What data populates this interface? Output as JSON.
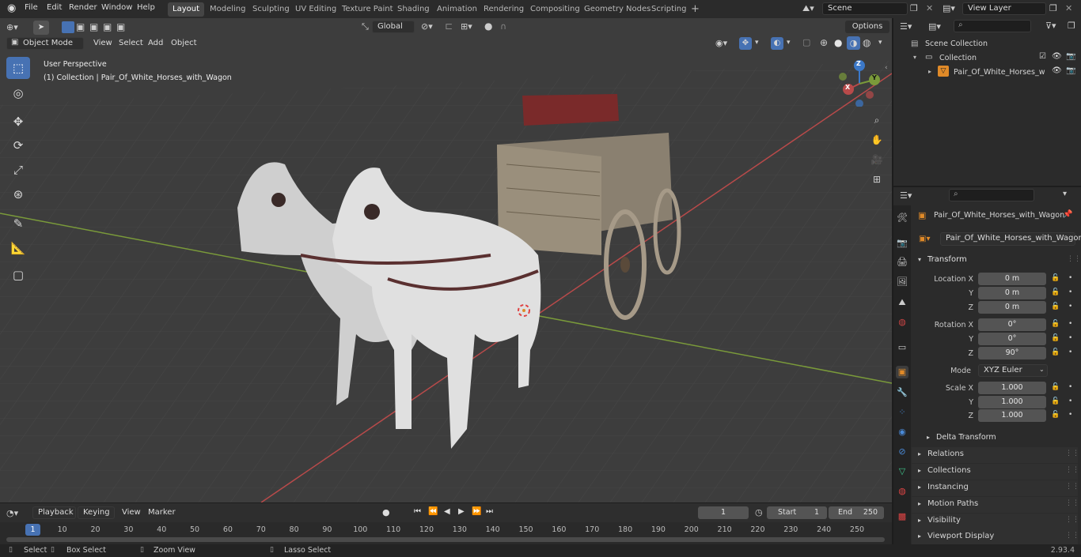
{
  "menubar": {
    "items": [
      "File",
      "Edit",
      "Render",
      "Window",
      "Help"
    ],
    "workspaces": [
      "Layout",
      "Modeling",
      "Sculpting",
      "UV Editing",
      "Texture Paint",
      "Shading",
      "Animation",
      "Rendering",
      "Compositing",
      "Geometry Nodes",
      "Scripting"
    ],
    "active_workspace": "Layout",
    "add_tab": "+",
    "scene": "Scene",
    "view_layer": "View Layer"
  },
  "toolbar": {
    "transform_orientation": "Global",
    "options": "Options"
  },
  "viewport_header": {
    "mode": "Object Mode",
    "menus": [
      "View",
      "Select",
      "Add",
      "Object"
    ]
  },
  "viewport": {
    "perspective": "User Perspective",
    "collection_info": "(1) Collection | Pair_Of_White_Horses_with_Wagon",
    "gizmo": {
      "z": "Z",
      "y": "Y",
      "x": "X"
    }
  },
  "outliner": {
    "scene_collection": "Scene Collection",
    "collection": "Collection",
    "object": "Pair_Of_White_Horses_w"
  },
  "properties": {
    "object_name": "Pair_Of_White_Horses_with_Wagon",
    "object_data_name": "Pair_Of_White_Horses_with_Wagon",
    "transform_title": "Transform",
    "location_label": "Location X",
    "rotation_label": "Rotation X",
    "scale_label": "Scale X",
    "y_label": "Y",
    "z_label": "Z",
    "location": [
      "0 m",
      "0 m",
      "0 m"
    ],
    "rotation": [
      "0°",
      "0°",
      "90°"
    ],
    "mode_label": "Mode",
    "mode_value": "XYZ Euler",
    "scale": [
      "1.000",
      "1.000",
      "1.000"
    ],
    "delta_transform": "Delta Transform",
    "sections": [
      "Relations",
      "Collections",
      "Instancing",
      "Motion Paths",
      "Visibility",
      "Viewport Display"
    ]
  },
  "timeline": {
    "menus": [
      "Playback",
      "Keying",
      "View",
      "Marker"
    ],
    "current_frame": "1",
    "start_label": "Start",
    "start": "1",
    "end_label": "End",
    "end": "250",
    "ruler": [
      "1",
      "10",
      "20",
      "30",
      "40",
      "50",
      "60",
      "70",
      "80",
      "90",
      "100",
      "110",
      "120",
      "130",
      "140",
      "150",
      "160",
      "170",
      "180",
      "190",
      "200",
      "210",
      "220",
      "230",
      "240",
      "250"
    ]
  },
  "statusbar": {
    "select": "Select",
    "box_select": "Box Select",
    "zoom_view": "Zoom View",
    "lasso_select": "Lasso Select",
    "version": "2.93.4"
  },
  "colors": {
    "accent": "#4772b3",
    "x_axis": "#b84a4a",
    "y_axis": "#7a9a3a",
    "z_axis": "#3b78c8",
    "object_orange": "#e08a28"
  }
}
